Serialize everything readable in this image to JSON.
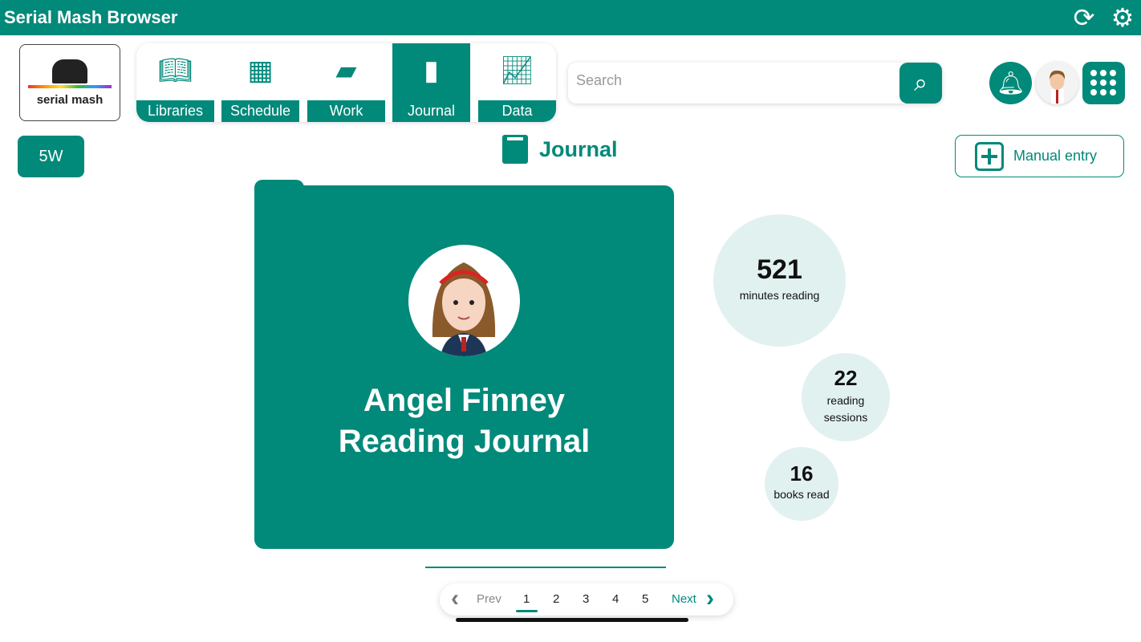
{
  "app": {
    "title": "Serial Mash Browser"
  },
  "logo": {
    "text": "serial mash"
  },
  "nav": [
    {
      "label": "Libraries",
      "icon": "book-open-icon"
    },
    {
      "label": "Schedule",
      "icon": "calendar-icon"
    },
    {
      "label": "Work",
      "icon": "folder-icon"
    },
    {
      "label": "Journal",
      "icon": "journal-icon",
      "active": true
    },
    {
      "label": "Data",
      "icon": "chart-icon"
    }
  ],
  "search": {
    "placeholder": "Search",
    "value": ""
  },
  "class_button": "5W",
  "page_title": "Journal",
  "manual_entry": "Manual entry",
  "journal": {
    "line1": "Angel Finney",
    "line2": "Reading Journal"
  },
  "stats": [
    {
      "value": "521",
      "label": "minutes reading"
    },
    {
      "value": "22",
      "label": "reading sessions"
    },
    {
      "value": "16",
      "label": "books read"
    }
  ],
  "pager": {
    "prev": "Prev",
    "next": "Next",
    "pages": [
      "1",
      "2",
      "3",
      "4",
      "5"
    ],
    "current": "1"
  },
  "colors": {
    "accent": "#01897a",
    "stat_bg": "#e1f1f0"
  }
}
